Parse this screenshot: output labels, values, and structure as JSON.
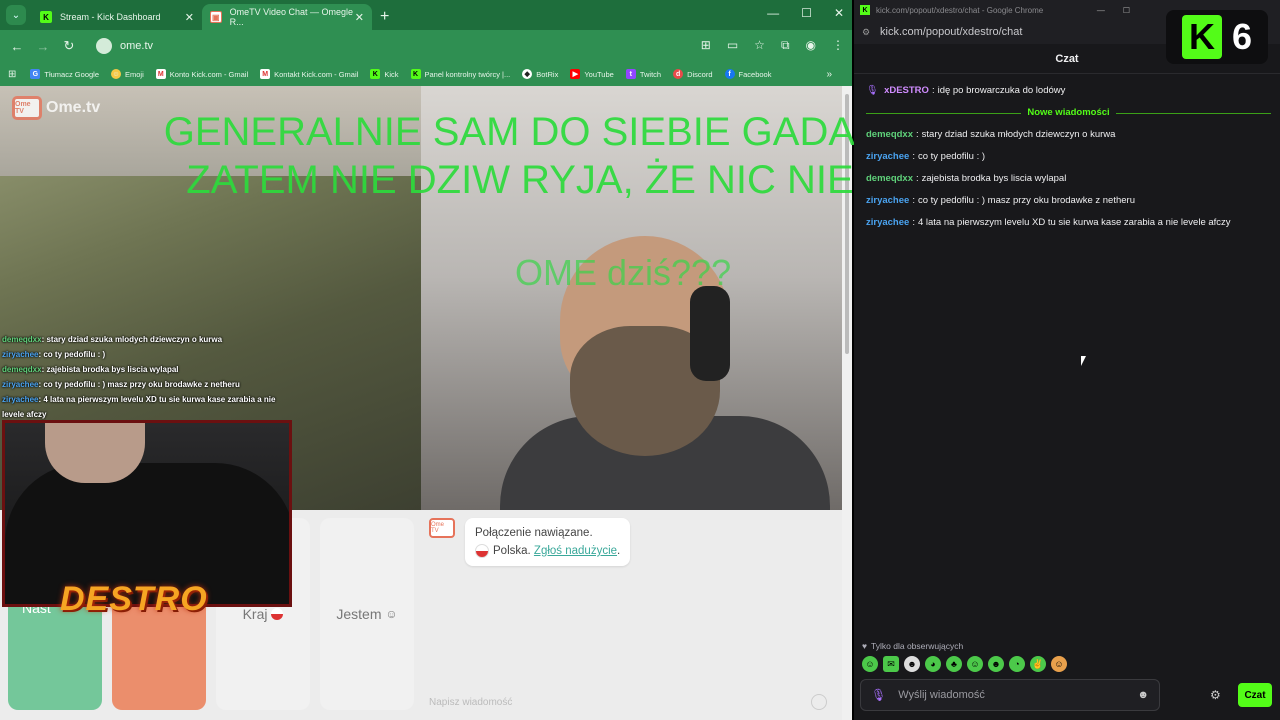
{
  "browser_left": {
    "tabs": [
      {
        "label": "Stream - Kick Dashboard",
        "active": false
      },
      {
        "label": "OmeTV Video Chat — Omegle R...",
        "active": true
      }
    ],
    "url": "ome.tv",
    "bookmarks": [
      {
        "label": "Tłumacz Google",
        "icon": "translate-icon"
      },
      {
        "label": "Emoji",
        "icon": "emoji-icon"
      },
      {
        "label": "Konto Kick.com - Gmail",
        "icon": "gmail-icon"
      },
      {
        "label": "Kontakt Kick.com - Gmail",
        "icon": "gmail-icon"
      },
      {
        "label": "Kick",
        "icon": "kick-icon"
      },
      {
        "label": "Panel kontrolny twórcy |...",
        "icon": "kick-icon"
      },
      {
        "label": "BotRix",
        "icon": "botrix-icon"
      },
      {
        "label": "YouTube",
        "icon": "youtube-icon"
      },
      {
        "label": "Twitch",
        "icon": "twitch-icon"
      },
      {
        "label": "Discord",
        "icon": "discord-icon"
      },
      {
        "label": "Facebook",
        "icon": "facebook-icon"
      }
    ]
  },
  "ometv": {
    "logo": "Ome.tv",
    "logo_box": "Ome TV",
    "buttons": {
      "next": "Nast",
      "country": "Kraj",
      "gender": "Jestem"
    },
    "system_message": {
      "connected": "Połączenie nawiązane.",
      "country": "Polska.",
      "report": "Zgłoś nadużycie",
      "report_suffix": "."
    },
    "input_placeholder": "Napisz wiadomość"
  },
  "overlay": {
    "headline_1": "GENERALNIE SAM DO SIEBIE GADAŁ NIE BĘDĘ,",
    "headline_2": "ZATEM NIE DZIW RYJA, ŻE NIC NIE MÓWIĘ :)...",
    "subtitle": "OME dziś???",
    "streamer_logo": "DESTRO",
    "chat": [
      {
        "user": "demeqdxx",
        "text": ": stary dziad szuka mlodych dziewczyn o kurwa"
      },
      {
        "user": "ziryachee",
        "text": ": co ty pedofilu : )"
      },
      {
        "user": "demeqdxx",
        "text": ": zajebista brodka bys liscia wylapal"
      },
      {
        "user": "ziryachee",
        "text": ": co ty pedofilu : ) masz przy oku brodawke z netheru"
      },
      {
        "user": "ziryachee",
        "text": ": 4 lata na pierwszym levelu XD tu sie kurwa kase zarabia a nie levele afczy"
      }
    ]
  },
  "kick_window": {
    "title": "kick.com/popout/xdestro/chat - Google Chrome",
    "url": "kick.com/popout/xdestro/chat",
    "header": "Czat",
    "badge_number": "6",
    "pinned": {
      "user": "xDESTRO",
      "text": "idę po browarczuka do lodówy"
    },
    "new_messages_divider": "Nowe wiadomości",
    "messages": [
      {
        "user": "demeqdxx",
        "text": "stary dziad szuka młodych dziewczyn o kurwa",
        "color": "#5fd17a"
      },
      {
        "user": "ziryachee",
        "text": "co ty pedofilu : )",
        "color": "#4aa3f0"
      },
      {
        "user": "demeqdxx",
        "text": "zajebista brodka bys liscia wylapal",
        "color": "#5fd17a"
      },
      {
        "user": "ziryachee",
        "text": "co ty pedofilu : ) masz przy oku brodawke z netheru",
        "color": "#4aa3f0"
      },
      {
        "user": "ziryachee",
        "text": "4 lata na pierwszym levelu XD tu sie kurwa kase zarabia a nie levele afczy",
        "color": "#4aa3f0"
      }
    ],
    "followers_only": "Tylko dla obserwujących",
    "input_placeholder": "Wyślij wiadomość",
    "send_label": "Czat"
  },
  "colors": {
    "kick_green": "#53fc18",
    "chrome_green": "#2f8f52",
    "overlay_green": "#2ddb3c",
    "ometv_accent": "#e6735a"
  }
}
